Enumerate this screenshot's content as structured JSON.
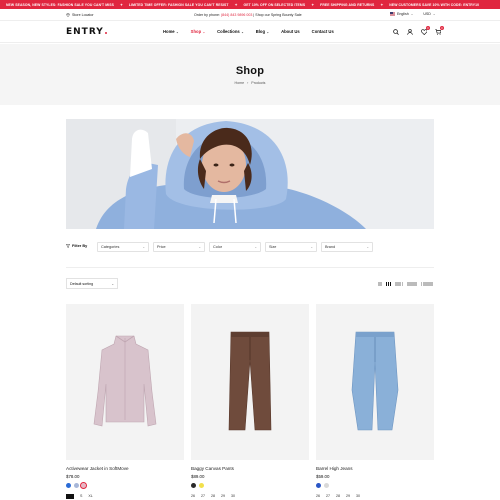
{
  "announcements": [
    "NEW SEASON, NEW STYLES: FASHION SALE YOU CAN'T MISS",
    "LIMITED TIME OFFER: FASHION SALE YOU CAN'T RESIST",
    "GET 10% OFF ON SELECTED ITEMS",
    "FREE SHIPPING AND RETURNS",
    "NEW CUSTOMERS SAVE 10% WITH CODE: ENTRY10"
  ],
  "utility": {
    "store_locator": "Store Locator",
    "order_prefix": "Order by phone:",
    "phone": "(844) 843 9896 003",
    "order_suffix": "| Shop our Spring Bounty Sale",
    "language": "English",
    "currency": "USD"
  },
  "logo": "ENTRY",
  "nav": {
    "home": "Home",
    "shop": "Shop",
    "collections": "Collections",
    "blog": "Blog",
    "about": "About Us",
    "contact": "Contact Us"
  },
  "header_icons": [
    "search-icon",
    "user-icon",
    "heart-icon",
    "cart-icon"
  ],
  "badges": {
    "wishlist": "0",
    "cart": "0"
  },
  "page": {
    "title": "Shop",
    "breadcrumb_home": "Home",
    "breadcrumb_current": "Products"
  },
  "filters": {
    "label": "Filter By",
    "categories": "Categories",
    "price": "Price",
    "color": "Color",
    "size": "Size",
    "brand": "Brand"
  },
  "sorting": {
    "selected": "Default sorting"
  },
  "products": [
    {
      "name": "Activewear Jacket in SoftMove",
      "price": "$78.00",
      "swatches": [
        "#2a6bd6",
        "#a7b7d9",
        "#e6b8c6"
      ],
      "sizes": [
        "",
        "S",
        "XL"
      ]
    },
    {
      "name": "Baggy Canvas Pants",
      "price": "$89.00",
      "swatches": [
        "#2a2a2a",
        "#f2e04c"
      ],
      "sizes": [
        "26",
        "27",
        "28",
        "29",
        "30"
      ]
    },
    {
      "name": "Barrel High Jeans",
      "price": "$59.00",
      "swatches": [
        "#2a56c6",
        "#d9d9d9"
      ],
      "sizes": [
        "26",
        "27",
        "28",
        "29",
        "30"
      ]
    }
  ],
  "colors": {
    "accent": "#e0263f",
    "banner_bg": "#f5f5f5",
    "card_bg": "#f3f3f3"
  }
}
